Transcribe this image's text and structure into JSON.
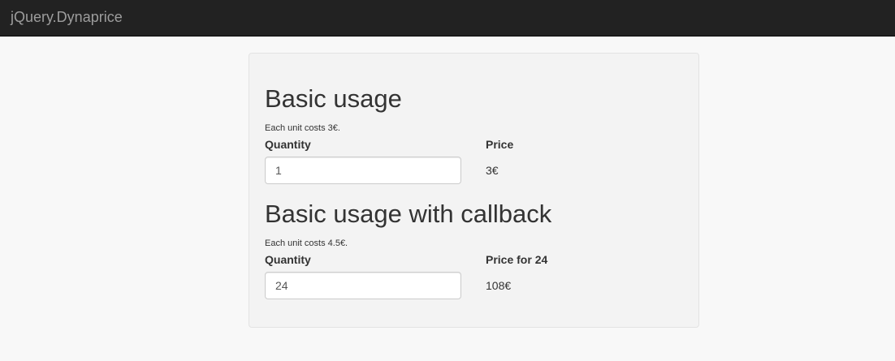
{
  "navbar": {
    "brand": "jQuery.Dynaprice"
  },
  "sections": [
    {
      "title": "Basic usage",
      "description": "Each unit costs 3€.",
      "quantity_label": "Quantity",
      "quantity_value": "1",
      "price_label": "Price",
      "price_value": "3€"
    },
    {
      "title": "Basic usage with callback",
      "description": "Each unit costs 4.5€.",
      "quantity_label": "Quantity",
      "quantity_value": "24",
      "price_label": "Price for 24",
      "price_value": "108€"
    }
  ]
}
